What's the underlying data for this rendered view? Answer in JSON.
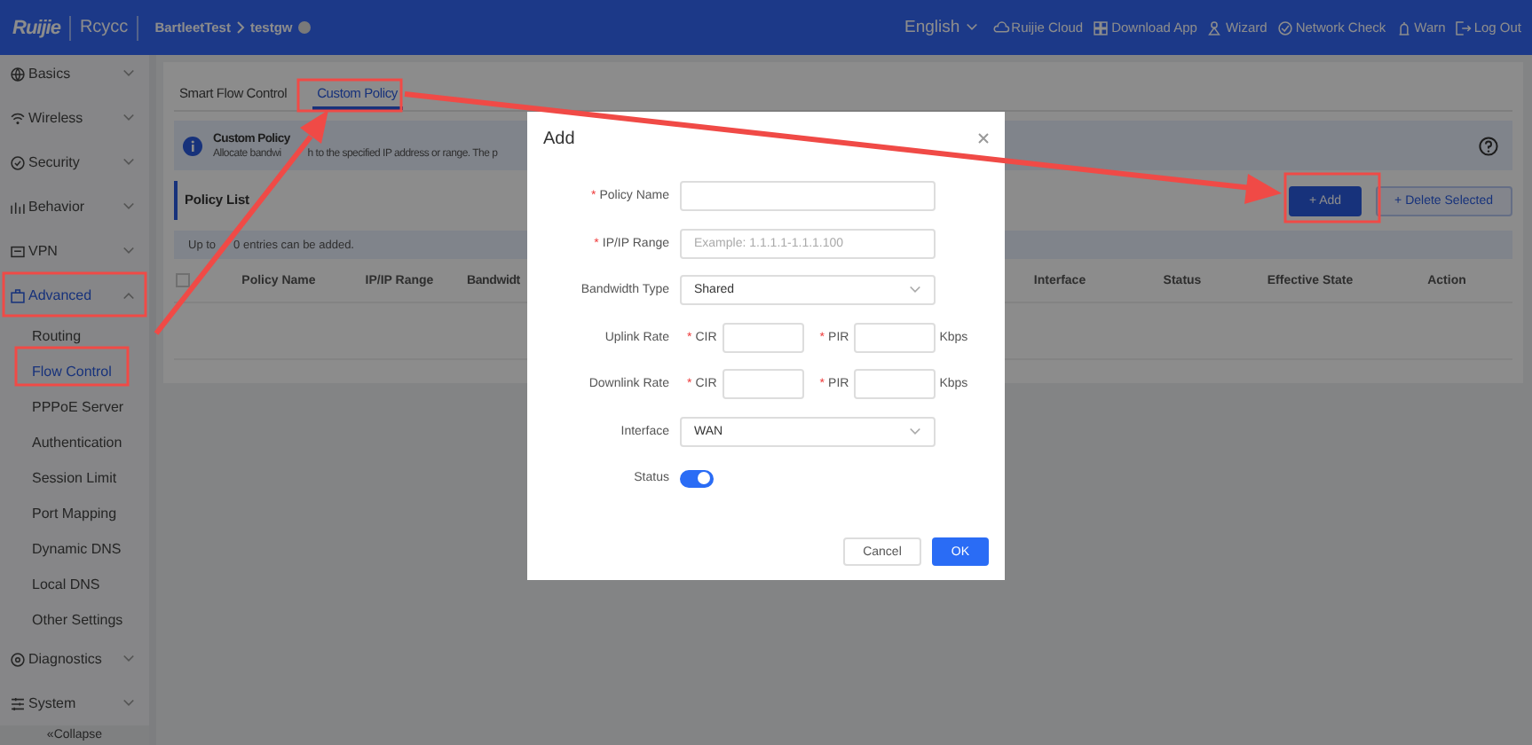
{
  "header": {
    "logo": "Ruijie",
    "logo_sub": "Rcycc",
    "breadcrumb": [
      "BartleetTest",
      "testgw"
    ],
    "nav": [
      {
        "label": "English",
        "kind": "language"
      },
      {
        "label": "Ruijie Cloud",
        "kind": "cloud"
      },
      {
        "label": "Download App",
        "kind": "app"
      },
      {
        "label": "Wizard",
        "kind": "wizard"
      },
      {
        "label": "Network Check",
        "kind": "check"
      },
      {
        "label": "Warn",
        "kind": "warn"
      },
      {
        "label": "Log Out",
        "kind": "logout"
      }
    ]
  },
  "sidebar": {
    "items": [
      {
        "label": "Basics",
        "kind": "globe",
        "expanded": false,
        "selected": false
      },
      {
        "label": "Wireless",
        "kind": "wifi",
        "expanded": false,
        "selected": false
      },
      {
        "label": "Security",
        "kind": "shield",
        "expanded": false,
        "selected": false
      },
      {
        "label": "Behavior",
        "kind": "chart",
        "expanded": false,
        "selected": false
      },
      {
        "label": "VPN",
        "kind": "vpn",
        "expanded": false,
        "selected": false
      },
      {
        "label": "Advanced",
        "kind": "case",
        "expanded": true,
        "selected": true,
        "children": [
          {
            "label": "Routing",
            "selected": false
          },
          {
            "label": "Flow Control",
            "selected": true
          },
          {
            "label": "PPPoE Server",
            "selected": false
          },
          {
            "label": "Authentication",
            "selected": false
          },
          {
            "label": "Session Limit",
            "selected": false
          },
          {
            "label": "Port Mapping",
            "selected": false
          },
          {
            "label": "Dynamic DNS",
            "selected": false
          },
          {
            "label": "Local DNS",
            "selected": false
          },
          {
            "label": "Other Settings",
            "selected": false
          }
        ]
      },
      {
        "label": "Diagnostics",
        "kind": "diag",
        "expanded": false,
        "selected": false
      },
      {
        "label": "System",
        "kind": "system",
        "expanded": false,
        "selected": false
      }
    ],
    "collapse": "«Collapse"
  },
  "tabs": [
    {
      "label": "Smart Flow Control",
      "selected": false
    },
    {
      "label": "Custom Policy",
      "selected": true
    }
  ],
  "info": {
    "title": "Custom Policy",
    "text_parts": [
      "Allocate bandwi",
      "h to the specified IP address or range. The p"
    ]
  },
  "section": {
    "title": "Policy List",
    "buttons": [
      {
        "label": "+ Add",
        "kind": "primary"
      },
      {
        "label": "+ Delete Selected",
        "kind": "secondary"
      }
    ]
  },
  "note_parts": [
    "Up to",
    "0 entries can be added."
  ],
  "table": {
    "select_all_checked": false,
    "columns": [
      "Policy Name",
      "IP/IP Range",
      "Bandwidt",
      "Interface",
      "Status",
      "Effective State",
      "Action"
    ]
  },
  "dialog": {
    "title": "Add",
    "fields": [
      {
        "kind": "text",
        "label": "Policy Name",
        "required_mark": "*"
      },
      {
        "kind": "text",
        "label": "IP/IP Range",
        "required_mark": "*",
        "placeholder": "Example: 1.1.1.1-1.1.1.100"
      },
      {
        "kind": "select",
        "label": "Bandwidth Type",
        "value": "Shared"
      },
      {
        "kind": "rate",
        "label": "Uplink Rate",
        "parts": [
          {
            "label": "CIR",
            "required_mark": "*"
          },
          {
            "label": "PIR",
            "required_mark": "*"
          }
        ],
        "unit": "Kbps"
      },
      {
        "kind": "rate",
        "label": "Downlink Rate",
        "parts": [
          {
            "label": "CIR",
            "required_mark": "*"
          },
          {
            "label": "PIR",
            "required_mark": "*"
          }
        ],
        "unit": "Kbps"
      },
      {
        "kind": "select",
        "label": "Interface",
        "value": "WAN"
      },
      {
        "kind": "switch",
        "label": "Status",
        "on": true
      }
    ],
    "buttons": [
      {
        "label": "Cancel",
        "kind": "secondary"
      },
      {
        "label": "OK",
        "kind": "primary"
      }
    ]
  }
}
